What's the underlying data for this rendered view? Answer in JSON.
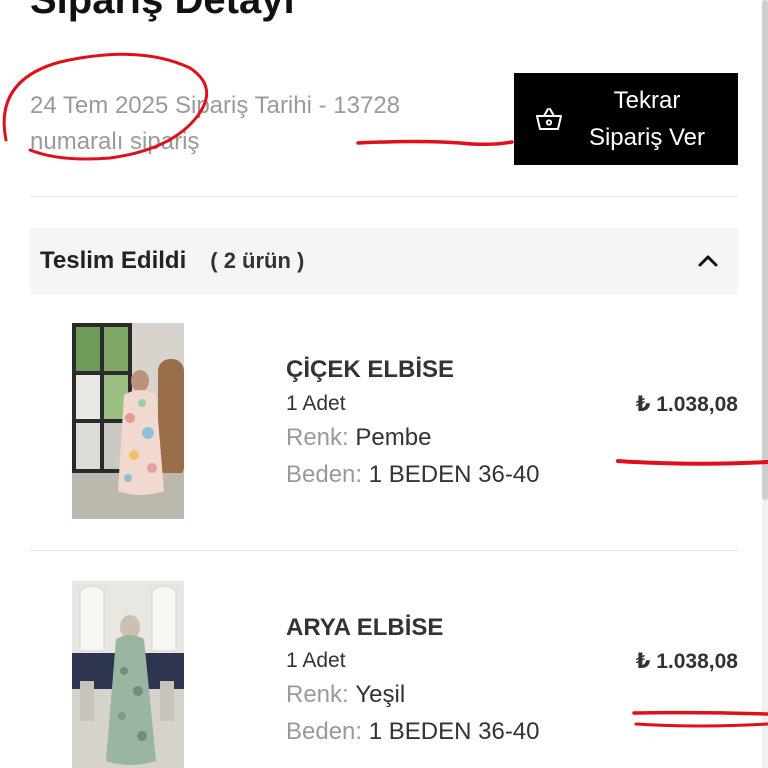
{
  "page": {
    "title": "Sipariş Detayı"
  },
  "order": {
    "meta_line1": "24 Tem 2025 Sipariş Tarihi - 13728",
    "meta_line2": "numaralı sipariş"
  },
  "reorder_button": {
    "label": "Tekrar\nSipariş Ver",
    "icon": "basket-icon"
  },
  "group": {
    "status": "Teslim Edildi",
    "count": "( 2 ürün )",
    "toggle_icon": "chevron-up-icon"
  },
  "items": [
    {
      "name": "ÇİÇEK ELBİSE",
      "quantity": "1 Adet",
      "color_label": "Renk:",
      "color": "Pembe",
      "size_label": "Beden:",
      "size": "1 BEDEN 36-40",
      "price": "₺ 1.038,08"
    },
    {
      "name": "ARYA ELBİSE",
      "quantity": "1 Adet",
      "color_label": "Renk:",
      "color": "Yeşil",
      "size_label": "Beden:",
      "size": "1 BEDEN 36-40",
      "price": "₺ 1.038,08"
    }
  ],
  "colors": {
    "button_bg": "#000000",
    "status_bg": "#f5f5f5",
    "annotation_red": "#e0101a"
  }
}
